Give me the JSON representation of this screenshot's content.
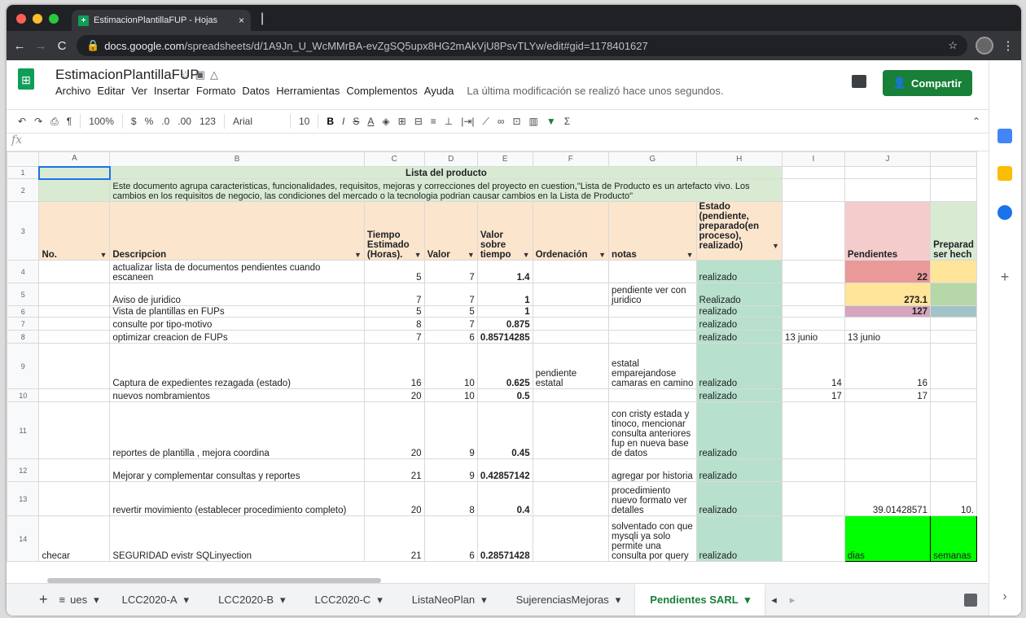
{
  "browser": {
    "tab_title": "EstimacionPlantillaFUP - Hojas",
    "url_host": "docs.google.com",
    "url_path": "/spreadsheets/d/1A9Jn_U_WcMMrBA-evZgSQ5upx8HG2mAkVjU8PsvTLYw/edit#gid=1178401627"
  },
  "doc": {
    "title": "EstimacionPlantillaFUP",
    "menus": [
      "Archivo",
      "Editar",
      "Ver",
      "Insertar",
      "Formato",
      "Datos",
      "Herramientas",
      "Complementos",
      "Ayuda"
    ],
    "last_edit": "La última modificación se realizó hace unos segundos.",
    "share_label": "Compartir"
  },
  "toolbar": {
    "zoom": "100%",
    "currency": "$",
    "percent": "%",
    "dec_less": ".0",
    "dec_more": ".00",
    "format": "123",
    "font": "Arial",
    "font_size": "10"
  },
  "columns": [
    "A",
    "B",
    "C",
    "D",
    "E",
    "F",
    "G",
    "H",
    "I",
    "J",
    ""
  ],
  "rows": {
    "r1": {
      "num": "1",
      "title": "Lista del producto"
    },
    "r2": {
      "num": "2",
      "desc": "Este documento agrupa caracteristicas, funcionalidades, requisitos, mejoras y correcciones del proyecto en cuestion,\"Lista de Producto es un artefacto vivo. Los cambios en los requisitos de negocio, las condiciones del mercado o la tecnologia podrian causar cambios en la Lista de Producto\""
    },
    "r3": {
      "num": "3",
      "a": "No.",
      "b": "Descripcion",
      "c": "Tiempo Estimado (Horas).",
      "d": "Valor",
      "e": "Valor sobre tiempo",
      "f": "Ordenación",
      "g": "notas",
      "h": "Estado (pendiente, preparado(en proceso), realizado)",
      "j": "Pendientes",
      "k": "Preparad ser hech"
    },
    "r4": {
      "num": "4",
      "b": "actualizar lista de documentos pendientes cuando escaneen",
      "c": "5",
      "d": "7",
      "e": "1.4",
      "h": "realizado",
      "j": "22"
    },
    "r5": {
      "num": "5",
      "b": "Aviso de juridico",
      "c": "7",
      "d": "7",
      "e": "1",
      "g": "pendiente ver con juridico",
      "h": "Realizado",
      "j": "273.1"
    },
    "r6": {
      "num": "6",
      "b": "Vista de plantillas en FUPs",
      "c": "5",
      "d": "5",
      "e": "1",
      "h": "realizado",
      "j": "127"
    },
    "r7": {
      "num": "7",
      "b": "consulte por tipo-motivo",
      "c": "8",
      "d": "7",
      "e": "0.875",
      "h": "realizado"
    },
    "r8": {
      "num": "8",
      "b": "optimizar creacion de FUPs",
      "c": "7",
      "d": "6",
      "e": "0.85714285",
      "h": "realizado",
      "i": "13 junio",
      "j": "13 junio"
    },
    "r9": {
      "num": "9",
      "b": "Captura de expedientes rezagada (estado)",
      "c": "16",
      "d": "10",
      "e": "0.625",
      "f": "pendiente estatal",
      "g": "estatal emparejandose camaras en camino",
      "h": "realizado",
      "i": "14",
      "j": "16"
    },
    "r10": {
      "num": "10",
      "b": "nuevos nombramientos",
      "c": "20",
      "d": "10",
      "e": "0.5",
      "h": "realizado",
      "i": "17",
      "j": "17"
    },
    "r11": {
      "num": "11",
      "b": "reportes de plantilla , mejora coordina",
      "c": "20",
      "d": "9",
      "e": "0.45",
      "g": "con cristy estada y tinoco, mencionar consulta anteriores fup en nueva base de datos",
      "h": "realizado"
    },
    "r12": {
      "num": "12",
      "b": "Mejorar y complementar consultas y reportes",
      "c": "21",
      "d": "9",
      "e": "0.42857142",
      "g": "agregar por historia",
      "h": "realizado"
    },
    "r13": {
      "num": "13",
      "b": "revertir movimiento (establecer procedimiento completo)",
      "c": "20",
      "d": "8",
      "e": "0.4",
      "g": "procedimiento nuevo formato ver detalles",
      "h": "realizado",
      "j": "39.01428571",
      "k": "10."
    },
    "r14": {
      "num": "14",
      "a": "checar",
      "b": "SEGURIDAD evistr SQLinyection",
      "c": "21",
      "d": "6",
      "e": "0.28571428",
      "g": "solventado con que mysqli ya solo permite una consulta por query",
      "h": "realizado",
      "j": "dias",
      "k": "semanas"
    }
  },
  "sheets": [
    "ues",
    "LCC2020-A",
    "LCC2020-B",
    "LCC2020-C",
    "ListaNeoPlan",
    "SujerenciasMejoras",
    "Pendientes SARL"
  ],
  "colors": {
    "peach": "#fce5cd",
    "green_state": "#b7e1cd",
    "bright_green": "#00ff00",
    "red_cell": "#ea9999",
    "yellow_cell": "#ffe599",
    "purple_cell": "#d5a6bd",
    "share_green": "#188038"
  }
}
